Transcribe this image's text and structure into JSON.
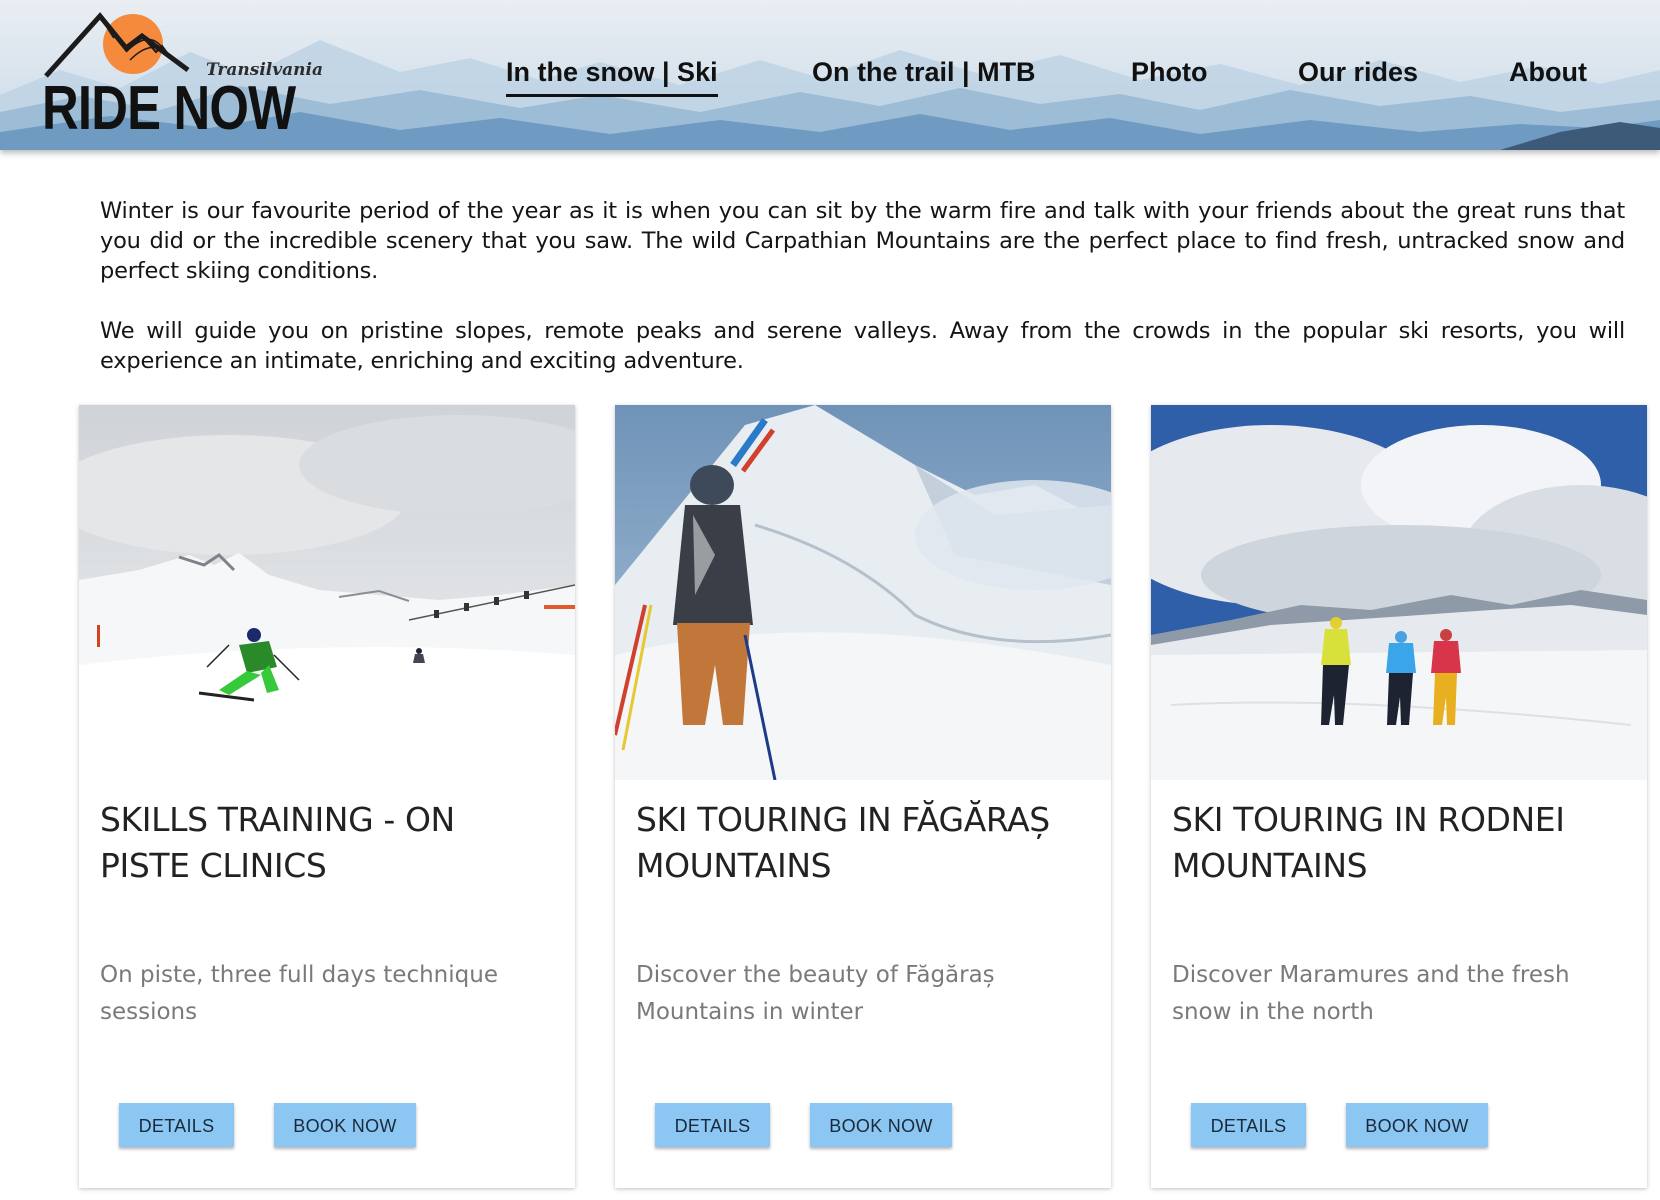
{
  "brand": {
    "name": "RIDE NOW",
    "region": "Transilvania",
    "sun_color": "#f58a3c"
  },
  "nav": {
    "items": [
      {
        "label": "In the snow | Ski",
        "active": true
      },
      {
        "label": "On the trail | MTB",
        "active": false
      },
      {
        "label": "Photo",
        "active": false
      },
      {
        "label": "Our rides",
        "active": false
      },
      {
        "label": "About",
        "active": false
      }
    ]
  },
  "intro": {
    "paragraphs": [
      "Winter is our favourite period of the year as it is when you can sit by the warm fire and talk with your friends about the great runs that you did or the incredible scenery that you saw. The wild Carpathian Mountains are the perfect place to find fresh, untracked snow and perfect skiing conditions.",
      "We will guide you on pristine slopes, remote peaks and serene valleys. Away from the crowds in the popular ski resorts, you will experience an intimate, enriching and exciting adventure."
    ]
  },
  "cards": [
    {
      "title": "SKILLS TRAINING - ON PISTE CLINICS",
      "description": "On piste, three full days technique sessions",
      "details_label": "DETAILS",
      "book_label": "BOOK NOW",
      "image": "skier-on-piste-photo"
    },
    {
      "title": "SKI TOURING IN FĂGĂRAȘ MOUNTAINS",
      "description": "Discover the beauty of Făgăraș Mountains in winter",
      "details_label": "DETAILS",
      "book_label": "BOOK NOW",
      "image": "ski-tourer-mountain-photo"
    },
    {
      "title": "SKI TOURING IN RODNEI MOUNTAINS",
      "description": "Discover Maramures and the fresh snow in the north",
      "details_label": "DETAILS",
      "book_label": "BOOK NOW",
      "image": "three-ski-tourers-photo"
    }
  ],
  "colors": {
    "button_bg": "#8cc6f3",
    "nav_text": "#111111",
    "card_desc": "#7a7a7a"
  }
}
